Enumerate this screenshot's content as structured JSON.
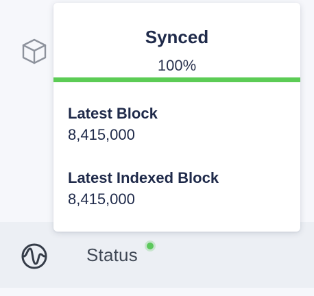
{
  "sidebar": {
    "items": [
      {
        "icon": "cube-icon",
        "label": ""
      },
      {
        "icon": "activity-pulse-icon",
        "label": "Status",
        "indicator_color": "#5cc85c"
      }
    ]
  },
  "sync_popover": {
    "title": "Synced",
    "percent_text": "100%",
    "progress": 1.0,
    "progress_color": "#5ccc55",
    "fields": [
      {
        "label": "Latest Block",
        "value": "8,415,000"
      },
      {
        "label": "Latest Indexed Block",
        "value": "8,415,000"
      }
    ]
  }
}
